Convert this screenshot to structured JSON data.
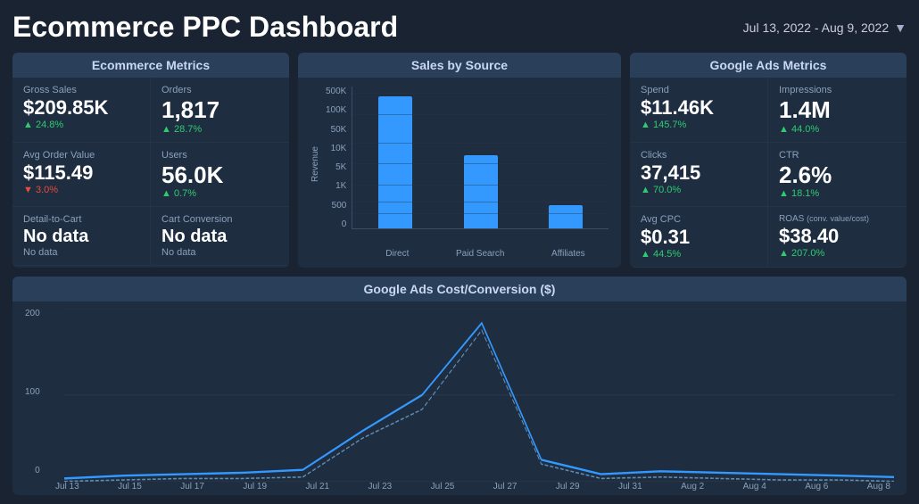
{
  "header": {
    "title": "Ecommerce PPC Dashboard",
    "date_range": "Jul 13, 2022 - Aug 9, 2022"
  },
  "ecommerce_panel": {
    "title": "Ecommerce Metrics",
    "metrics": [
      {
        "label": "Gross Sales",
        "value": "$209.85K",
        "change": "+24.8%",
        "direction": "positive"
      },
      {
        "label": "Orders",
        "value": "1,817",
        "change": "+28.7%",
        "direction": "positive"
      },
      {
        "label": "Avg Order Value",
        "value": "$115.49",
        "change": "-3.0%",
        "direction": "negative"
      },
      {
        "label": "Users",
        "value": "56.0K",
        "change": "+0.7%",
        "direction": "positive"
      },
      {
        "label": "Detail-to-Cart",
        "value": "No data",
        "change": "No data",
        "direction": "neutral"
      },
      {
        "label": "Cart Conversion",
        "value": "No data",
        "change": "No data",
        "direction": "neutral"
      }
    ]
  },
  "sales_panel": {
    "title": "Sales by Source",
    "y_labels": [
      "500K",
      "100K",
      "50K",
      "10K",
      "5K",
      "1K",
      "500",
      "0"
    ],
    "bars": [
      {
        "label": "Direct",
        "height_pct": 95
      },
      {
        "label": "Paid Search",
        "height_pct": 55
      },
      {
        "label": "Affiliates",
        "height_pct": 18
      }
    ],
    "y_axis_title": "Revenue"
  },
  "google_panel": {
    "title": "Google Ads Metrics",
    "metrics": [
      {
        "label": "Spend",
        "value": "$11.46K",
        "change": "+145.7%",
        "direction": "positive"
      },
      {
        "label": "Impressions",
        "value": "1.4M",
        "change": "+44.0%",
        "direction": "positive"
      },
      {
        "label": "Clicks",
        "value": "37,415",
        "change": "+70.0%",
        "direction": "positive"
      },
      {
        "label": "CTR",
        "value": "2.6%",
        "change": "+18.1%",
        "direction": "positive"
      },
      {
        "label": "Avg CPC",
        "value": "$0.31",
        "change": "+44.5%",
        "direction": "positive"
      },
      {
        "label": "ROAS (conv. value/cost)",
        "value": "$38.40",
        "change": "+207.0%",
        "direction": "positive"
      }
    ]
  },
  "bottom_panel": {
    "title": "Google Ads  Cost/Conversion ($)",
    "y_labels": [
      "200",
      "100",
      "0"
    ],
    "x_labels": [
      "Jul 13",
      "Jul 15",
      "Jul 17",
      "Jul 19",
      "Jul 21",
      "Jul 23",
      "Jul 25",
      "Jul 27",
      "Jul 29",
      "Jul 31",
      "Aug 2",
      "Aug 4",
      "Aug 6",
      "Aug 8"
    ]
  }
}
